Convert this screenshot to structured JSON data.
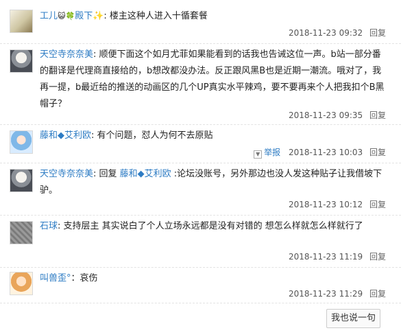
{
  "posts": [
    {
      "user": "工儿",
      "user_badges": "😺🍀",
      "user_suffix": "殿下✨",
      "sep": ": ",
      "text": "楼主这种人进入十循套餐",
      "date": "2018-11-23 09:32",
      "reply": "回复"
    },
    {
      "user": "天空寺奈奈美",
      "sep": ": ",
      "text": "顺便下面这个如月尤菲如果能看到的话我也告诫这位一声。b站一部分番的翻译是代理商直接给的，b想改都没办法。反正跟风黑B也是近期一潮流。哦对了，我再一提，b最近给的推送的动画区的几个UP真实水平辣鸡，要不要再来个人把我扣个B黑帽子？",
      "date": "2018-11-23 09:35",
      "reply": "回复"
    },
    {
      "user": "藤和◆艾利欧",
      "sep": ": ",
      "text": "有个问题，怼人为何不去原贴",
      "report": "举报",
      "date": "2018-11-23 10:03",
      "reply": "回复"
    },
    {
      "user": "天空寺奈奈美",
      "sep": ": ",
      "reply_prefix": "回复 ",
      "reply_to": "藤和◆艾利欧",
      "text": " :论坛没账号，另外那边也没人发这种贴子让我借坡下驴。",
      "date": "2018-11-23 10:12",
      "reply": "回复"
    },
    {
      "user": "石球",
      "sep": ": ",
      "text": "支持层主 其实说白了个人立场永远都是没有对错的 想怎么样就怎么样就行了",
      "date": "2018-11-23 11:19",
      "reply": "回复"
    },
    {
      "user": "叫兽歪°",
      "sep": "：",
      "text": "哀伤",
      "date": "2018-11-23 11:29",
      "reply": "回复"
    }
  ],
  "say_button": "我也说一句"
}
